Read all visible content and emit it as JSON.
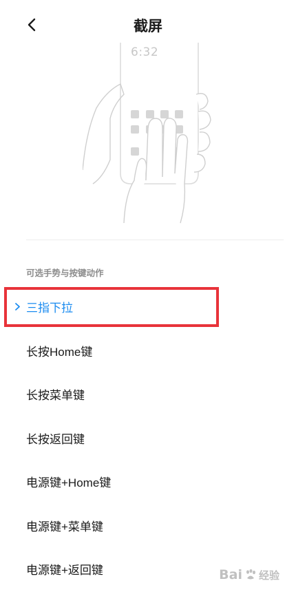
{
  "header": {
    "title": "截屏",
    "back_icon": "chevron-left-icon"
  },
  "illustration": {
    "clock_text": "6:32",
    "description_icon": "three-finger-swipe-icon"
  },
  "section": {
    "header": "可选手势与按键动作"
  },
  "options": [
    {
      "label": "三指下拉",
      "selected": true
    },
    {
      "label": "长按Home键",
      "selected": false
    },
    {
      "label": "长按菜单键",
      "selected": false
    },
    {
      "label": "长按返回键",
      "selected": false
    },
    {
      "label": "电源键+Home键",
      "selected": false
    },
    {
      "label": "电源键+菜单键",
      "selected": false
    },
    {
      "label": "电源键+返回键",
      "selected": false
    }
  ],
  "colors": {
    "accent": "#1a8bf0",
    "highlight": "#e8333a",
    "text": "#1a1a1a",
    "muted": "#8c8c8c"
  },
  "watermark": {
    "brand": "Bai",
    "suffix": "经验"
  }
}
